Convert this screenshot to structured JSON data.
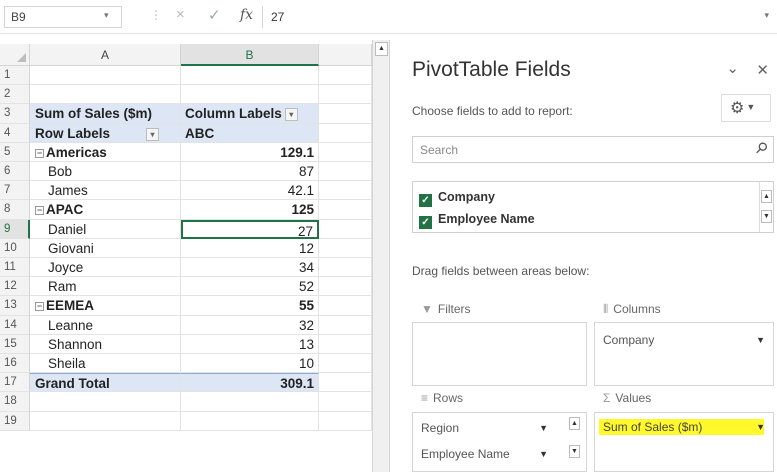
{
  "formula_bar": {
    "name_box": "B9",
    "cancel_icon": "×",
    "enter_icon": "✓",
    "fx_label": "fx",
    "formula": "27"
  },
  "sheet": {
    "columns": [
      "A",
      "B"
    ],
    "rows": [
      {
        "num": "1",
        "a": "",
        "b": ""
      },
      {
        "num": "2",
        "a": "",
        "b": ""
      },
      {
        "num": "3",
        "a": "Sum of Sales ($m)",
        "b": "Column Labels"
      },
      {
        "num": "4",
        "a": "Row Labels",
        "b": "ABC"
      },
      {
        "num": "5",
        "a": "Americas",
        "b": "129.1"
      },
      {
        "num": "6",
        "a": "Bob",
        "b": "87"
      },
      {
        "num": "7",
        "a": "James",
        "b": "42.1"
      },
      {
        "num": "8",
        "a": "APAC",
        "b": "125"
      },
      {
        "num": "9",
        "a": "Daniel",
        "b": "27"
      },
      {
        "num": "10",
        "a": "Giovani",
        "b": "12"
      },
      {
        "num": "11",
        "a": "Joyce",
        "b": "34"
      },
      {
        "num": "12",
        "a": "Ram",
        "b": "52"
      },
      {
        "num": "13",
        "a": "EEMEA",
        "b": "55"
      },
      {
        "num": "14",
        "a": "Leanne",
        "b": "32"
      },
      {
        "num": "15",
        "a": "Shannon",
        "b": "13"
      },
      {
        "num": "16",
        "a": "Sheila",
        "b": "10"
      },
      {
        "num": "17",
        "a": "Grand Total",
        "b": "309.1"
      },
      {
        "num": "18",
        "a": "",
        "b": ""
      },
      {
        "num": "19",
        "a": "",
        "b": ""
      }
    ],
    "selected_cell": "B9"
  },
  "pivot_pane": {
    "title": "PivotTable Fields",
    "subtitle": "Choose fields to add to report:",
    "search_placeholder": "Search",
    "fields": [
      "Company",
      "Employee Name"
    ],
    "drag_hint": "Drag fields between areas below:",
    "areas": {
      "filters_label": "Filters",
      "columns_label": "Columns",
      "columns_items": [
        "Company"
      ],
      "rows_label": "Rows",
      "rows_items": [
        "Region",
        "Employee Name"
      ],
      "values_label": "Values",
      "values_items": [
        "Sum of Sales ($m)"
      ]
    },
    "highlight_color": "#fff82a",
    "checkbox_color": "#217346"
  }
}
